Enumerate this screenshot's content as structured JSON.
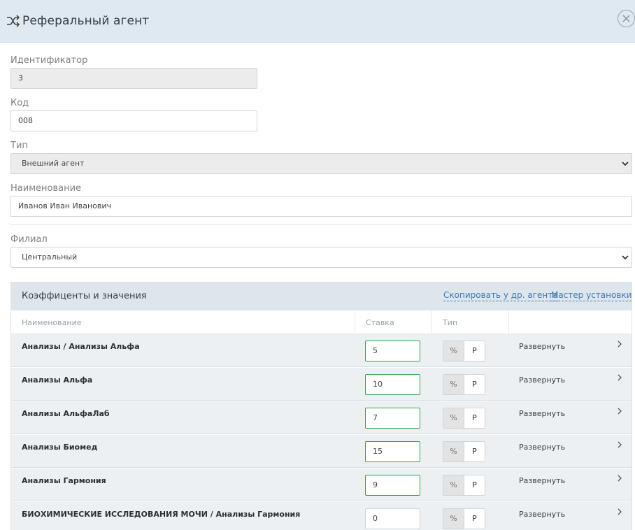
{
  "header": {
    "title": "Реферальный агент",
    "icon": "shuffle-icon",
    "close_icon": "close-icon"
  },
  "form": {
    "id_label": "Идентификатор",
    "id_value": "3",
    "code_label": "Код",
    "code_value": "008",
    "type_label": "Тип",
    "type_value": "Внешний агент",
    "name_label": "Наименование",
    "name_value": "Иванов Иван Иванович",
    "branch_label": "Филиал",
    "branch_value": "Центральный"
  },
  "panel": {
    "title": "Коэффиценты и значения",
    "copy_link": "Скопировать у др. агента",
    "wizard_link": "Мастер установки",
    "columns": {
      "name": "Наименование",
      "rate": "Ставка",
      "type": "Тип"
    },
    "rows": [
      {
        "name": "Анализы / Анализы Альфа",
        "rate": "5",
        "pct": "%",
        "rub": "Р",
        "expand": "Развернуть"
      },
      {
        "name": "Анализы Альфа",
        "rate": "10",
        "pct": "%",
        "rub": "Р",
        "expand": "Развернуть"
      },
      {
        "name": "Анализы АльфаЛаб",
        "rate": "7",
        "pct": "%",
        "rub": "Р",
        "expand": "Развернуть"
      },
      {
        "name": "Анализы Биомед",
        "rate": "15",
        "pct": "%",
        "rub": "Р",
        "expand": "Развернуть"
      },
      {
        "name": "Анализы Гармония",
        "rate": "9",
        "pct": "%",
        "rub": "Р",
        "expand": "Развернуть"
      },
      {
        "name": "БИОХИМИЧЕСКИЕ ИССЛЕДОВАНИЯ МОЧИ / Анализы Гармония",
        "rate": "0",
        "pct": "%",
        "rub": "Р",
        "expand": "Развернуть"
      }
    ]
  },
  "colors": {
    "header_bg": "#dfe9f1",
    "link": "#3d79b9",
    "rate_border": "#2ea44f",
    "row_bg": "#ecf0f2"
  }
}
